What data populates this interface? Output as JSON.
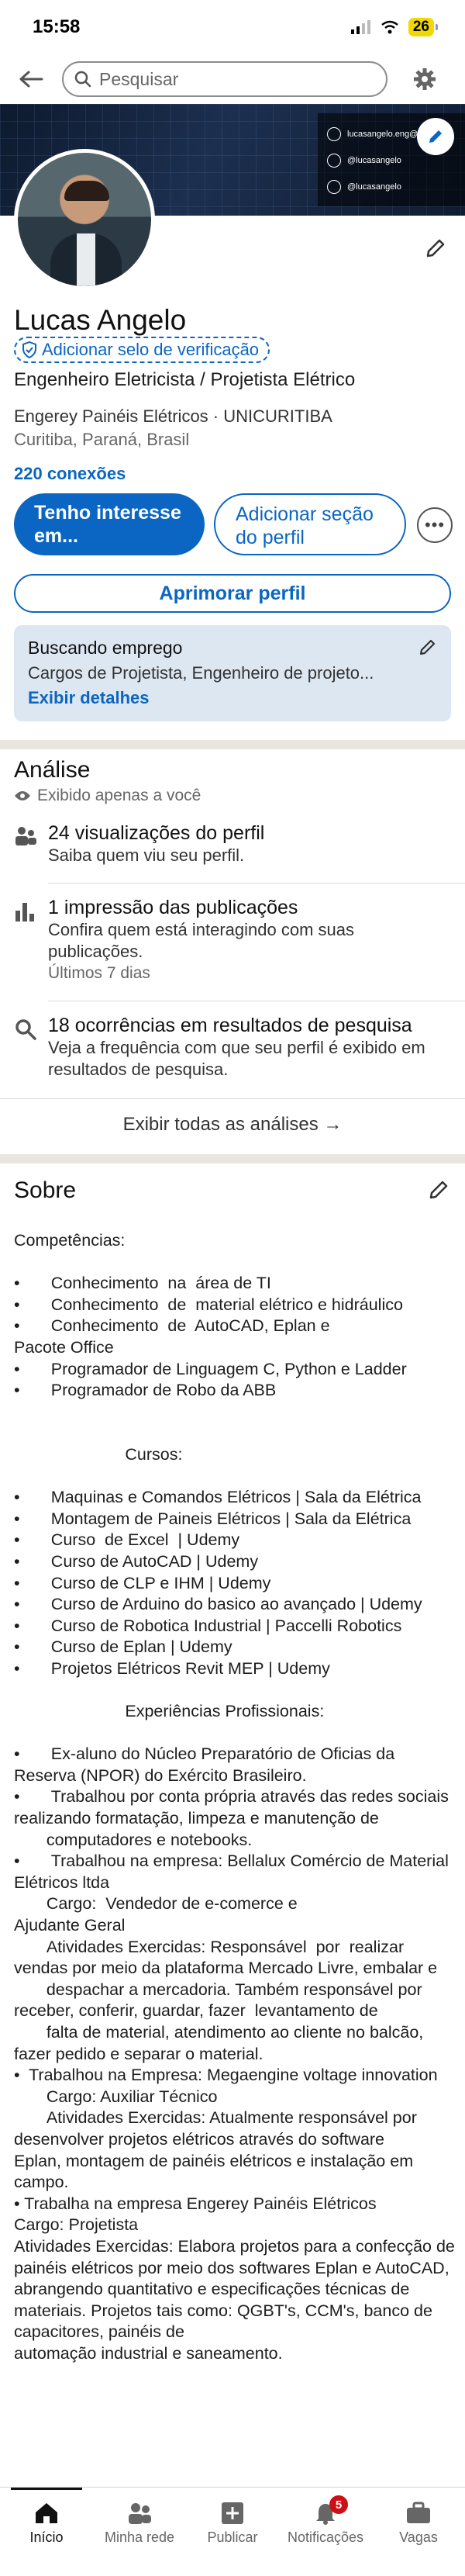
{
  "status_bar": {
    "time": "15:58",
    "battery": "26"
  },
  "search": {
    "placeholder": "Pesquisar"
  },
  "banner": {
    "contacts": [
      "lucasangelo.eng@...",
      "@lucasangelo",
      "@lucasangelo"
    ]
  },
  "profile": {
    "name": "Lucas Angelo",
    "verify_badge": "Adicionar selo de verificação",
    "headline": "Engenheiro Eletricista / Projetista Elétrico",
    "company": "Engerey Painéis Elétricos · UNICURITIBA",
    "location": "Curitiba, Paraná, Brasil",
    "connections": "220 conexões",
    "btn_interest_line1": "Tenho interesse",
    "btn_interest_line2": "em...",
    "btn_add_section_line1": "Adicionar seção",
    "btn_add_section_line2": "do perfil",
    "btn_more": "•••",
    "btn_improve": "Aprimorar perfil"
  },
  "open_to_work": {
    "title": "Buscando emprego",
    "description": "Cargos de Projetista, Engenheiro de projeto...",
    "link": "Exibir detalhes"
  },
  "analytics": {
    "title": "Análise",
    "private": "Exibido apenas a você",
    "metrics": [
      {
        "title": "24 visualizações do perfil",
        "sub": "Saiba quem viu seu perfil.",
        "sub2": ""
      },
      {
        "title": "1 impressão das publicações",
        "sub": "Confira quem está interagindo com suas publicações.",
        "sub2": "Últimos 7 dias"
      },
      {
        "title": "18 ocorrências em resultados de pesquisa",
        "sub": "Veja a frequência com que seu perfil é exibido em resultados de pesquisa.",
        "sub2": ""
      }
    ],
    "show_all": "Exibir todas as análises →"
  },
  "about": {
    "title": "Sobre",
    "text": "Competências:\n\n•\tConhecimento  na  área de TI\n•\tConhecimento  de  material elétrico e hidráulico\n•\tConhecimento  de  AutoCAD, Eplan e\nPacote Office\n•\tProgramador de Linguagem C, Python e Ladder\n•\tProgramador de Robo da ABB\n\n\n                        Cursos:\n\n•\tMaquinas e Comandos Elétricos | Sala da Elétrica\n•\tMontagem de Paineis Elétricos | Sala da Elétrica\n•\tCurso  de Excel  | Udemy\n•\tCurso de AutoCAD | Udemy\n•\tCurso de CLP e IHM | Udemy\n•\tCurso de Arduino do basico ao avançado | Udemy\n•\tCurso de Robotica Industrial | Paccelli Robotics\n•\tCurso de Eplan | Udemy\n•\tProjetos Elétricos Revit MEP | Udemy\n\n                        Experiências Profissionais:\n\n•\tEx-aluno do Núcleo Preparatório de Oficias da Reserva (NPOR) do Exército Brasileiro.\n•\tTrabalhou por conta própria através das redes sociais realizando formatação, limpeza e manutenção de\n       computadores e notebooks.\n•\tTrabalhou na empresa: Bellalux Comércio de Material Elétricos ltda\n       Cargo:  Vendedor de e-comerce e\nAjudante Geral\n       Atividades Exercidas: Responsável  por  realizar vendas por meio da plataforma Mercado Livre, embalar e\n       despachar a mercadoria. Também responsável por receber, conferir, guardar, fazer  levantamento de\n       falta de material, atendimento ao cliente no balcão, fazer pedido e separar o material.\n•  Trabalhou na Empresa: Megaengine voltage innovation\n       Cargo: Auxiliar Técnico\n       Atividades Exercidas: Atualmente responsável por desenvolver projetos elétricos através do software\nEplan, montagem de painéis elétricos e instalação em campo.\n• Trabalha na empresa Engerey Painéis Elétricos\nCargo: Projetista\nAtividades Exercidas: Elabora projetos para a confecção de painéis elétricos por meio dos softwares Eplan e AutoCAD, abrangendo quantitativo e especificações técnicas de\nmateriais. Projetos tais como: QGBT's, CCM's, banco de capacitores, painéis de\nautomação industrial e saneamento."
  },
  "bottom_nav": [
    {
      "label": "Início",
      "icon": "home-icon",
      "active": true
    },
    {
      "label": "Minha rede",
      "icon": "network-icon",
      "active": false
    },
    {
      "label": "Publicar",
      "icon": "post-icon",
      "active": false
    },
    {
      "label": "Notificações",
      "icon": "bell-icon",
      "active": false,
      "badge": "5"
    },
    {
      "label": "Vagas",
      "icon": "briefcase-icon",
      "active": false
    }
  ]
}
